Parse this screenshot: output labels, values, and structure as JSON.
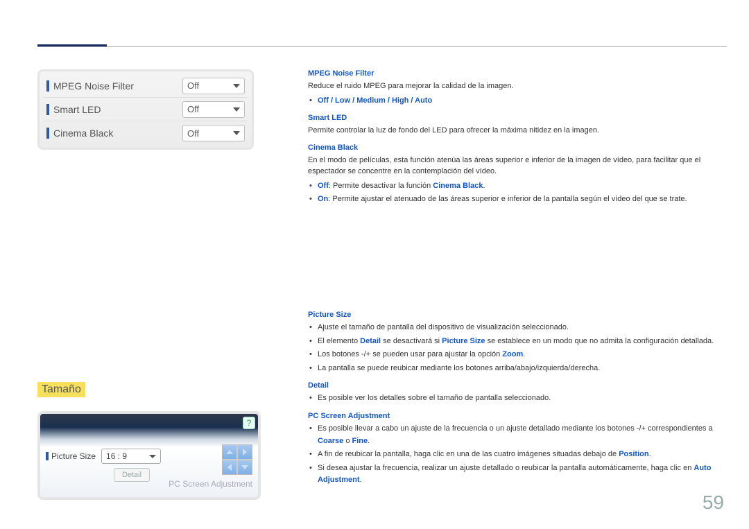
{
  "menu": {
    "rows": [
      {
        "label": "MPEG Noise Filter",
        "value": "Off"
      },
      {
        "label": "Smart LED",
        "value": "Off"
      },
      {
        "label": "Cinema Black",
        "value": "Off"
      }
    ]
  },
  "desc": {
    "mpeg": {
      "title": "MPEG Noise Filter",
      "text": "Reduce el ruido MPEG para mejorar la calidad de la imagen.",
      "options": "Off / Low / Medium / High / Auto"
    },
    "smartled": {
      "title": "Smart LED",
      "text": "Permite controlar la luz de fondo del LED para ofrecer la máxima nitidez en la imagen."
    },
    "cinema": {
      "title": "Cinema Black",
      "text": "En el modo de películas, esta función atenúa las áreas superior e inferior de la imagen de vídeo, para facilitar que el espectador se concentre en la contemplación del vídeo.",
      "off_bold": "Off",
      "off_text": ": Permite desactivar la función ",
      "off_bold2": "Cinema Black",
      "on_bold": "On",
      "on_text": ": Permite ajustar el atenuado de las áreas superior e inferior de la pantalla según el vídeo del que se trate."
    }
  },
  "section2": {
    "title": "Tamaño",
    "picture_size_label": "Picture Size",
    "picture_size_value": "16 : 9",
    "detail_btn": "Detail",
    "pc_adj_label": "PC Screen Adjustment",
    "help": "?"
  },
  "sec2desc": {
    "ps": {
      "title": "Picture Size",
      "b1": "Ajuste el tamaño de pantalla del dispositivo de visualización seleccionado.",
      "b2_p1": "El elemento ",
      "b2_b1": "Detail",
      "b2_p2": " se desactivará si ",
      "b2_b2": "Picture Size",
      "b2_p3": " se establece en un modo que no admita la configuración detallada.",
      "b3_p1": "Los botones -/+ se pueden usar para ajustar la opción ",
      "b3_b1": "Zoom",
      "b4": "La pantalla se puede reubicar mediante los botones arriba/abajo/izquierda/derecha."
    },
    "detail": {
      "title": "Detail",
      "b1": "Es posible ver los detalles sobre el tamaño de pantalla seleccionado."
    },
    "pcadj": {
      "title": "PC Screen Adjustment",
      "b1_p1": "Es posible llevar a cabo un ajuste de la frecuencia o un ajuste detallado mediante los botones -/+ correspondientes a ",
      "b1_b1": "Coarse",
      "b1_p2": " o ",
      "b1_b2": "Fine",
      "b2_p1": "A fin de reubicar la pantalla, haga clic en una de las cuatro imágenes situadas debajo de ",
      "b2_b1": "Position",
      "b3_p1": "Si desea ajustar la frecuencia, realizar un ajuste detallado o reubicar la pantalla automáticamente, haga clic en ",
      "b3_b1": "Auto Adjustment"
    }
  },
  "page": "59"
}
